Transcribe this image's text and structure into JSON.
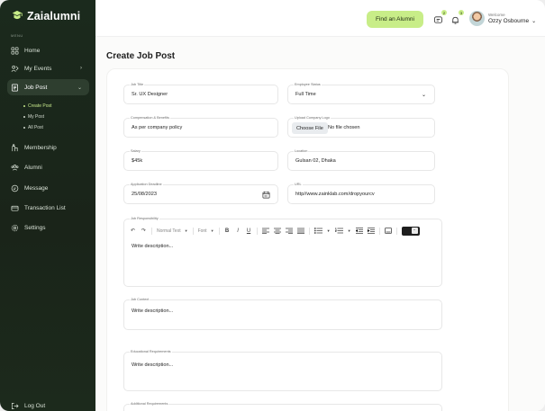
{
  "app": {
    "logo_text": "Zaialumni",
    "menu_caption": "MENU"
  },
  "sidebar": {
    "items": [
      {
        "label": "Home",
        "icon": "grid-icon"
      },
      {
        "label": "My Events",
        "icon": "events-icon",
        "has_chevron": true
      },
      {
        "label": "Job Post",
        "icon": "briefcase-icon",
        "has_chevron": true,
        "active": true
      },
      {
        "label": "Membership",
        "icon": "membership-icon"
      },
      {
        "label": "Alumni",
        "icon": "users-icon"
      },
      {
        "label": "Message",
        "icon": "message-icon"
      },
      {
        "label": "Transaction List",
        "icon": "card-icon"
      },
      {
        "label": "Settings",
        "icon": "settings-icon"
      }
    ],
    "sub_items": [
      {
        "label": "Create Post",
        "active": true
      },
      {
        "label": "My Post"
      },
      {
        "label": "All Post"
      }
    ],
    "logout_label": "Log Out"
  },
  "topbar": {
    "find_button": "Find an Alumni",
    "message_badge": "2",
    "notification_badge": "3",
    "welcome": "Welcome",
    "user_name": "Ozzy Osbourne"
  },
  "page": {
    "title": "Create Job Post"
  },
  "form": {
    "job_title": {
      "label": "Job Title",
      "value": "Sr. UX Designer"
    },
    "employee_status": {
      "label": "Employee Status",
      "value": "Full Time"
    },
    "compensation": {
      "label": "Compensation & Benefits",
      "value": "As per company policy"
    },
    "company_logo": {
      "label": "Upload Company Logo",
      "button": "Choose File",
      "status": "No file chosen"
    },
    "salary": {
      "label": "Salary",
      "value": "$45k"
    },
    "location": {
      "label": "Location",
      "value": "Gulsan 02, Dhaka"
    },
    "deadline": {
      "label": "Application Deadline",
      "value": "25/08/2023"
    },
    "url": {
      "label": "URL",
      "value": "http//www.zainklab.com/dropyourcv"
    },
    "job_responsibility": {
      "label": "Job Responsibility",
      "placeholder": "Write description..."
    },
    "job_context": {
      "label": "Job Context",
      "placeholder": "Write description..."
    },
    "educational_requirements": {
      "label": "Educational Requirements",
      "placeholder": "Write description..."
    },
    "additional_requirements": {
      "label": "Additional Requirements"
    }
  },
  "toolbar": {
    "undo": "↶",
    "redo": "↷",
    "format_select": "Normal Text",
    "font_select": "Font",
    "bold": "B",
    "italic": "I",
    "underline": "U"
  },
  "colors": {
    "sidebar_bg": "#1b2a1d",
    "accent": "#c8ed88",
    "active_sub": "#c6e88b"
  }
}
